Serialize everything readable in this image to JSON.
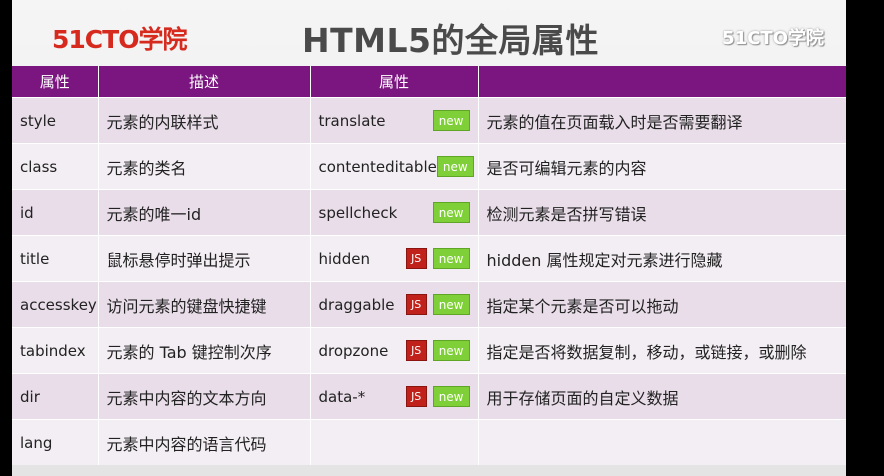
{
  "header": {
    "logo_left": "51CTO学院",
    "title": "HTML5的全局属性",
    "logo_right": "51CTO学院"
  },
  "table": {
    "headers": [
      "属性",
      "描述",
      "属性",
      ""
    ],
    "badge_labels": {
      "js": "JS",
      "new": "new"
    },
    "rows": [
      {
        "attr": "style",
        "desc": "元素的内联样式",
        "attr2": "translate",
        "js": false,
        "new": true,
        "desc2": "元素的值在页面载入时是否需要翻译"
      },
      {
        "attr": "class",
        "desc": "元素的类名",
        "attr2": "contenteditable",
        "js": false,
        "new": true,
        "desc2": "是否可编辑元素的内容"
      },
      {
        "attr": "id",
        "desc": "元素的唯一id",
        "attr2": "spellcheck",
        "js": false,
        "new": true,
        "desc2": "检测元素是否拼写错误"
      },
      {
        "attr": "title",
        "desc": "鼠标悬停时弹出提示",
        "attr2": "hidden",
        "js": true,
        "new": true,
        "desc2": "hidden 属性规定对元素进行隐藏"
      },
      {
        "attr": "accesskey",
        "desc": "访问元素的键盘快捷键",
        "attr2": "draggable",
        "js": true,
        "new": true,
        "desc2": "指定某个元素是否可以拖动"
      },
      {
        "attr": "tabindex",
        "desc": "元素的 Tab 键控制次序",
        "attr2": "dropzone",
        "js": true,
        "new": true,
        "desc2": "指定是否将数据复制，移动，或链接，或删除"
      },
      {
        "attr": "dir",
        "desc": "元素中内容的文本方向",
        "attr2": "data-*",
        "js": true,
        "new": true,
        "desc2": "用于存储页面的自定义数据"
      },
      {
        "attr": "lang",
        "desc": "元素中内容的语言代码",
        "attr2": "",
        "js": false,
        "new": false,
        "desc2": ""
      }
    ]
  }
}
